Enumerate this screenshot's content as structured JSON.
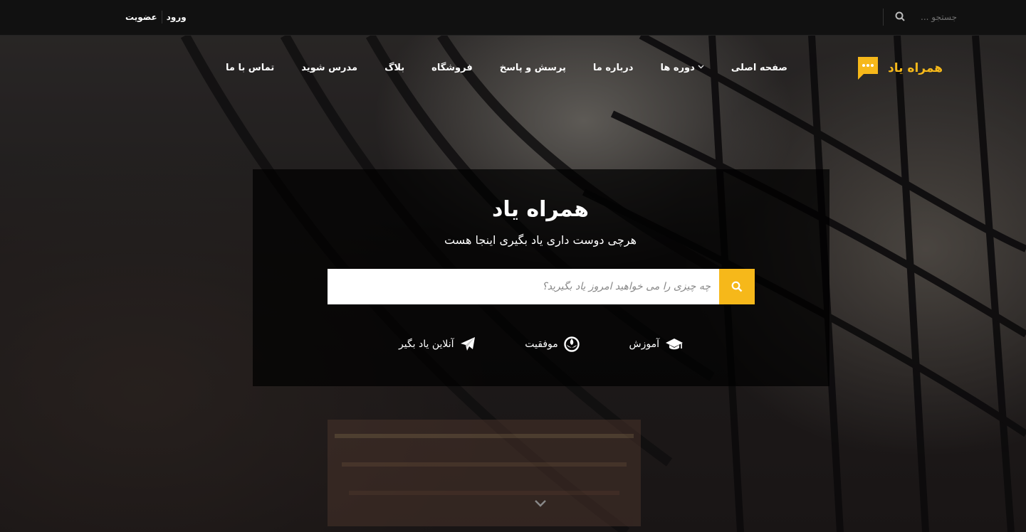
{
  "topbar": {
    "login_label": "ورود",
    "register_label": "عضویت",
    "search_placeholder": "جستجو ..."
  },
  "brand": {
    "logo_text": "همراه یاد",
    "accent_color": "#f6b81a"
  },
  "nav": {
    "items": [
      {
        "label": "صفحه اصلی"
      },
      {
        "label": "دوره ها",
        "has_dropdown": true
      },
      {
        "label": "درباره ما"
      },
      {
        "label": "پرسش و پاسخ"
      },
      {
        "label": "فروشگاه"
      },
      {
        "label": "بلاگ"
      },
      {
        "label": "مدرس شوید"
      },
      {
        "label": "تماس با ما"
      }
    ]
  },
  "hero": {
    "title": "همراه یاد",
    "subtitle": "هرچی دوست داری یاد بگیری اینجا هست",
    "search_placeholder": "چه چیزی را می خواهید امروز یاد بگیرید؟",
    "features": [
      {
        "label": "آموزش",
        "icon": "graduation-cap-icon"
      },
      {
        "label": "موفقیت",
        "icon": "rebel-icon"
      },
      {
        "label": "آنلاین یاد بگیر",
        "icon": "paper-plane-icon"
      }
    ]
  }
}
